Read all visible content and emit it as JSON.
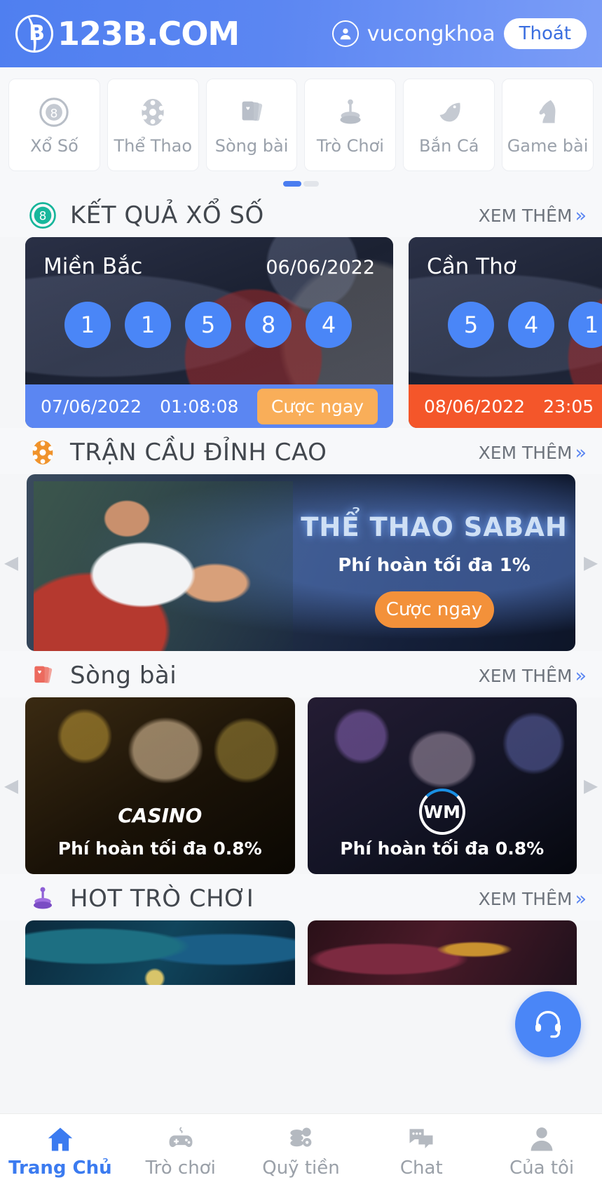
{
  "header": {
    "brand": "123B.COM",
    "brand_mark": "B",
    "username": "vucongkhoa",
    "logout_label": "Thoát",
    "user_icon": "user-circle-icon",
    "bg_color": "#5b86f2"
  },
  "categories": [
    {
      "label": "Xổ Số",
      "icon": "lottery-ball-8-icon"
    },
    {
      "label": "Thể Thao",
      "icon": "soccer-ball-icon"
    },
    {
      "label": "Sòng bài",
      "icon": "playing-cards-icon"
    },
    {
      "label": "Trò Chơi",
      "icon": "joystick-icon"
    },
    {
      "label": "Bắn Cá",
      "icon": "fish-icon"
    },
    {
      "label": "Game bài",
      "icon": "chess-knight-icon"
    }
  ],
  "pager": {
    "active_index": 0,
    "count": 2
  },
  "sections": {
    "lottery": {
      "title": "KẾT QUẢ XỔ SỐ",
      "icon": "lottery-ball-8-icon",
      "more_label": "XEM THÊM",
      "more_chevron": "»",
      "cards": [
        {
          "region": "Miền Bắc",
          "date": "06/06/2022",
          "numbers": [
            "1",
            "1",
            "5",
            "8",
            "4"
          ],
          "next_date": "07/06/2022",
          "countdown": "01:08:08",
          "bet_label": "Cược ngay",
          "bar_color": "#5b86f2"
        },
        {
          "region": "Cần Thơ",
          "date": "",
          "numbers": [
            "5",
            "4",
            "1"
          ],
          "next_date": "08/06/2022",
          "countdown": "23:05",
          "bet_label": "",
          "bar_color": "#f4562a"
        }
      ]
    },
    "sports": {
      "title": "TRẬN CẦU ĐỈNH CAO",
      "icon": "soccer-ball-icon",
      "more_label": "XEM THÊM",
      "more_chevron": "»",
      "banner": {
        "title": "THỂ THAO SABAH",
        "subtitle": "Phí hoàn tối đa 1%",
        "button": "Cược ngay"
      }
    },
    "casino": {
      "title": "Sòng bài",
      "icon": "playing-cards-icon",
      "more_label": "XEM THÊM",
      "more_chevron": "»",
      "cards": [
        {
          "logo": "CASINO",
          "logo_kind": "n-casino-logo",
          "caption": "Phí hoàn tối đa 0.8%"
        },
        {
          "logo": "WM",
          "logo_kind": "wm-casino-logo",
          "caption": "Phí hoàn tối đa 0.8%"
        }
      ]
    },
    "hotgames": {
      "title": "HOT TRÒ CHƠI",
      "icon": "joystick-icon",
      "more_label": "XEM THÊM",
      "more_chevron": "»"
    }
  },
  "support_fab": {
    "icon": "headset-icon"
  },
  "bottom_nav": {
    "active_index": 0,
    "items": [
      {
        "label": "Trang Chủ",
        "icon": "home-icon"
      },
      {
        "label": "Trò chơi",
        "icon": "gamepad-icon"
      },
      {
        "label": "Quỹ tiền",
        "icon": "coins-gear-icon"
      },
      {
        "label": "Chat",
        "icon": "chat-bubbles-icon"
      },
      {
        "label": "Của tôi",
        "icon": "person-icon"
      }
    ]
  }
}
